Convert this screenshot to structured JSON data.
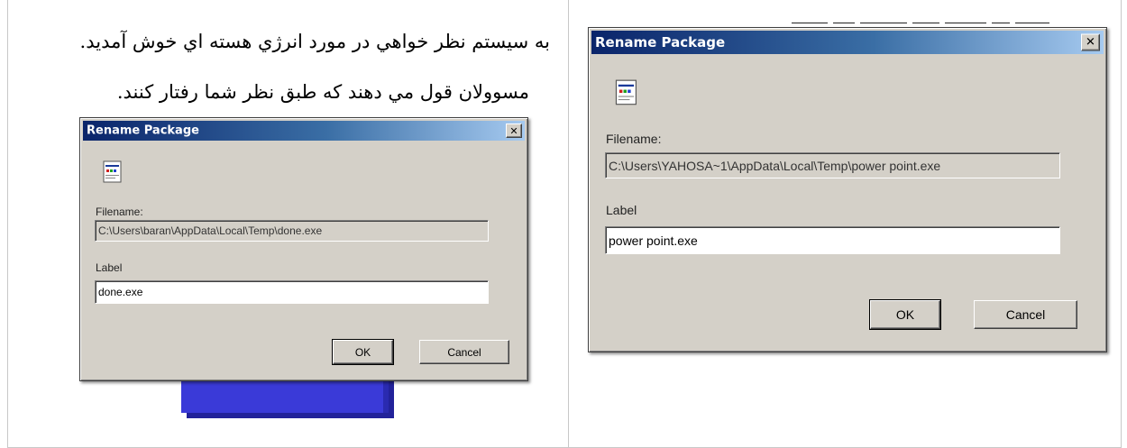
{
  "left_panel": {
    "persian_lines": [
      "به سیستم نظر خواهي در مورد انرژي هسته اي خوش آمدید.",
      "مسوولان قول مي دهند که طبق نظر شما رفتار کنند."
    ],
    "dialog": {
      "title": "Rename Package",
      "close_glyph": "✕",
      "icon": "package-icon",
      "filename_label": "Filename:",
      "filename_value": "C:\\Users\\baran\\AppData\\Local\\Temp\\done.exe",
      "label_label": "Label",
      "label_value": "done.exe",
      "ok_label": "OK",
      "cancel_label": "Cancel"
    }
  },
  "right_panel": {
    "dialog": {
      "title": "Rename Package",
      "close_glyph": "✕",
      "icon": "package-icon",
      "filename_label": "Filename:",
      "filename_value": "C:\\Users\\YAHOSA~1\\AppData\\Local\\Temp\\power point.exe",
      "label_label": "Label",
      "label_value": "power point.exe",
      "ok_label": "OK",
      "cancel_label": "Cancel"
    }
  },
  "colors": {
    "dialog_face": "#d4d0c8",
    "titlebar_start": "#0a246a",
    "titlebar_end": "#a6caf0",
    "blue_block": "#3a3ad8"
  }
}
